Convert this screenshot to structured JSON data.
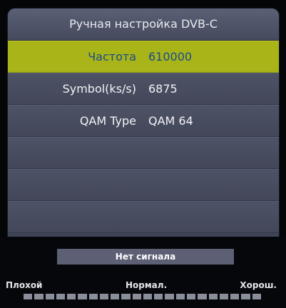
{
  "header": {
    "title": "Ручная настройка DVB-C"
  },
  "rows": [
    {
      "label": "Частота",
      "value": "610000",
      "selected": true
    },
    {
      "label": "Symbol(ks/s)",
      "value": "6875",
      "selected": false
    },
    {
      "label": "QAM Type",
      "value": "QAM 64",
      "selected": false
    },
    {
      "label": "",
      "value": "",
      "selected": false
    },
    {
      "label": "",
      "value": "",
      "selected": false
    },
    {
      "label": "",
      "value": "",
      "selected": false
    }
  ],
  "status": {
    "signal_text": "Нет сигнала",
    "quality_low": "Плохой",
    "quality_mid": "Нормал.",
    "quality_high": "Хорош.",
    "signal_level": 0
  },
  "colors": {
    "selected_row": "#a8b418",
    "selected_text": "#1b4b8e",
    "panel": "#3f4458"
  }
}
